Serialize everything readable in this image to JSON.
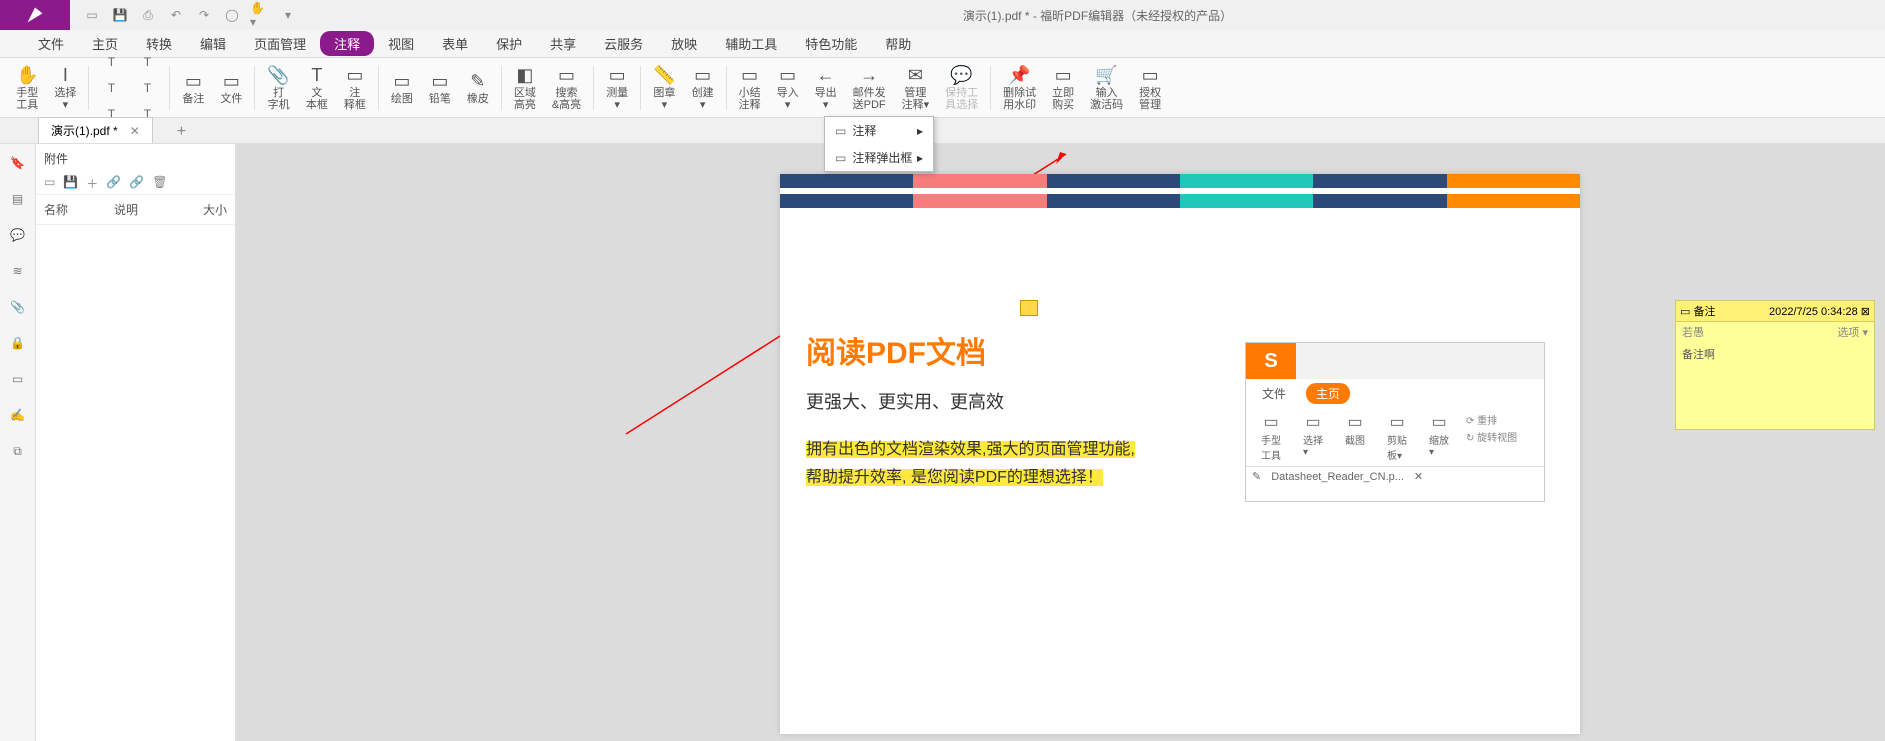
{
  "title": "演示(1).pdf * - 福昕PDF编辑器（未经授权的产品）",
  "menus": [
    "文件",
    "主页",
    "转换",
    "编辑",
    "页面管理",
    "注释",
    "视图",
    "表单",
    "保护",
    "共享",
    "云服务",
    "放映",
    "辅助工具",
    "特色功能",
    "帮助"
  ],
  "active_menu": "注释",
  "ribbon": [
    {
      "label": "手型\n工具"
    },
    {
      "label": "选择\n▾"
    },
    {
      "sep": true
    },
    {
      "mini": true
    },
    {
      "sep": true
    },
    {
      "label": "备注"
    },
    {
      "label": "文件"
    },
    {
      "sep": true
    },
    {
      "label": "打\n字机"
    },
    {
      "label": "文\n本框"
    },
    {
      "label": "注\n释框"
    },
    {
      "sep": true
    },
    {
      "label": "绘图"
    },
    {
      "label": "铅笔"
    },
    {
      "label": "橡皮"
    },
    {
      "sep": true
    },
    {
      "label": "区域\n高亮"
    },
    {
      "label": "搜索\n&高亮"
    },
    {
      "sep": true
    },
    {
      "label": "测量\n▾"
    },
    {
      "sep": true
    },
    {
      "label": "图章\n▾"
    },
    {
      "label": "创建\n▾"
    },
    {
      "sep": true
    },
    {
      "label": "小结\n注释"
    },
    {
      "label": "导入\n▾"
    },
    {
      "label": "导出\n▾"
    },
    {
      "label": "邮件发\n送PDF"
    },
    {
      "label": "管理\n注释▾",
      "highlight": true
    },
    {
      "label": "保持工\n具选择",
      "disabled": true
    },
    {
      "sep": true
    },
    {
      "label": "删除试\n用水印"
    },
    {
      "label": "立即\n购买"
    },
    {
      "label": "输入\n激活码"
    },
    {
      "label": "授权\n管理"
    }
  ],
  "doc_tab": "演示(1).pdf *",
  "attach": {
    "title": "附件",
    "cols": [
      "名称",
      "说明",
      "大小"
    ]
  },
  "dropdown": [
    "注释",
    "注释弹出框"
  ],
  "page_doc": {
    "heading": "阅读PDF文档",
    "sub": "更强大、更实用、更高效",
    "hl1": "拥有出色的文档渲染效果,强大的页面管理功能,",
    "hl2": "帮助提升效率, 是您阅读PDF的理想选择！"
  },
  "sticky": {
    "title": "备注",
    "date": "2022/7/25 0:34:28",
    "author": "若愚",
    "options": "选项 ▾",
    "body": "备注啊"
  },
  "mini": {
    "tabs": [
      "文件",
      "主页"
    ],
    "buttons": [
      "手型\n工具",
      "选择\n▾",
      "截图",
      "剪贴\n板▾",
      "缩放\n▾"
    ],
    "side": [
      "⟳ 重排",
      "↻ 旋转视图"
    ],
    "doctab": "Datasheet_Reader_CN.p...",
    "edit_icon": "✎"
  },
  "color_strip": [
    "#2b4a7a",
    "#f77c7c",
    "#2b4a7a",
    "#1fc8b8",
    "#2b4a7a",
    "#ff8a00"
  ]
}
